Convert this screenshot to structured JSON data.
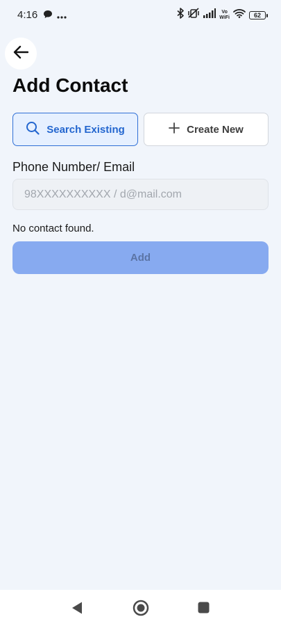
{
  "status_bar": {
    "time": "4:16",
    "battery": "62",
    "network_label_top": "Vo",
    "network_label_bottom": "WiFi"
  },
  "header": {
    "title": "Add Contact"
  },
  "tabs": [
    {
      "label": "Search Existing",
      "icon": "search-icon",
      "selected": true
    },
    {
      "label": "Create New",
      "icon": "plus-icon",
      "selected": false
    }
  ],
  "form": {
    "label": "Phone Number/ Email",
    "placeholder": "98XXXXXXXXXX / d@mail.com",
    "value": ""
  },
  "result_text": "No contact found.",
  "add_button_label": "Add",
  "colors": {
    "background": "#f1f5fb",
    "accent": "#2f6fd6",
    "add_button": "#87aaf0"
  }
}
